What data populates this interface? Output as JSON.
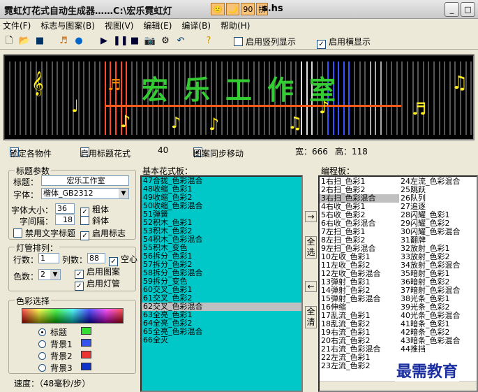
{
  "window": {
    "title": "霓虹灯花式自动生成器……C:\\宏乐霓虹灯",
    "ime": [
      "🙂",
      "🌙",
      "90",
      "拼"
    ],
    "title_suffix": "s.hs",
    "min": "_",
    "max": "□"
  },
  "menu": [
    "文件(F)",
    "标志与图案(B)",
    "视图(V)",
    "编辑(E)",
    "编译(B)",
    "帮助(H)"
  ],
  "toolbar": {
    "vertical_display": "启用竖列显示",
    "horizontal_display": "启用横显示"
  },
  "preview": {
    "title_text": "宏乐工作室",
    "bg": "#000000",
    "text_color": "#33cc33"
  },
  "status": {
    "lock_all": "锁定各物件",
    "enable_title_style": "启用标题花式",
    "count": "40",
    "pattern_sync": "图案同步移动",
    "width": "宽：666",
    "height": "高：118"
  },
  "title_params": {
    "legend": "标题参数",
    "title_label": "标题：",
    "title_value": "宏乐工作室",
    "font_label": "字体：",
    "font_value": "楷体_GB2312",
    "size_label": "字体大小：",
    "size_value": "36",
    "bold": "粗体",
    "spacing_label": "字间隔：",
    "spacing_value": "18",
    "italic": "斜体",
    "disable_text_title": "禁用文字标题",
    "enable_logo": "启用标志"
  },
  "tube": {
    "legend": "灯管排列：",
    "rows_label": "行数：",
    "rows_value": "1",
    "cols_label": "列数：",
    "cols_value": "88",
    "hollow": "空心",
    "colors_label": "色数：",
    "colors_value": "2",
    "enable_pattern": "启用图案",
    "enable_tube": "启用灯管"
  },
  "color": {
    "legend": "色彩选择",
    "options": [
      {
        "label": "标题",
        "color": "#33dd33"
      },
      {
        "label": "背景1",
        "color": "#3355ee"
      },
      {
        "label": "背景2",
        "color": "#ee3333"
      },
      {
        "label": "背景3",
        "color": "#1133cc"
      }
    ]
  },
  "speed": {
    "label": "速度：（48毫秒/步）"
  },
  "basic_board": {
    "legend": "基本花式板：",
    "items": [
      "47合拢_色彩混合",
      "48收缩_色彩1",
      "49收缩_色彩2",
      "50收缩_色彩混合",
      "51弹簧",
      "52积木_色彩1",
      "53积木_色彩2",
      "54积木_色彩混合",
      "55积木_变色",
      "56拆分_色彩1",
      "57拆分_色彩2",
      "58拆分_色彩混合",
      "59拆分_变色",
      "60交叉_色彩1",
      "61交叉_色彩2",
      "62交叉_色彩混合",
      "63全亮_色彩1",
      "64全亮_色彩2",
      "65全亮_色彩混合",
      "66全灭"
    ],
    "selected_index": 15
  },
  "side_buttons": {
    "right": "→",
    "select_all": "全选",
    "left": "←",
    "clear_all": "全清"
  },
  "edit_board": {
    "legend": "编程板：",
    "col1": [
      "1右扫_色彩1",
      "2右扫_色彩2",
      "3右扫_色彩混合",
      "4右收_色彩1",
      "5右收_色彩2",
      "6右收_色彩混合",
      "7左扫_色彩1",
      "8左扫_色彩2",
      "9左扫_色彩混合",
      "10左收_色彩1",
      "11左收_色彩2",
      "12左收_色彩混合",
      "13弹射_色彩1",
      "14弹射_色彩2",
      "15弹射_色彩混合",
      "16伸缩",
      "17乱流_色彩1",
      "18乱流_色彩2",
      "19右流_色彩1",
      "20右流_色彩2",
      "21右流_色彩混合",
      "22左流_色彩1",
      "23左流_色彩2"
    ],
    "col2": [
      "24左流_色彩混合",
      "25跳跃",
      "26队列",
      "27追逐",
      "28闪耀_色彩1",
      "29闪耀_色彩2",
      "30闪耀_色彩混合",
      "31翻牌",
      "32放射_色彩1",
      "33放射_色彩2",
      "34放射_色彩混合",
      "35暗射_色彩1",
      "36暗射_色彩2",
      "37暗射_色彩混合",
      "38光条_色彩1",
      "39光条_色彩2",
      "40光条_色彩混合",
      "41暗条_色彩1",
      "42暗条_色彩2",
      "43暗条_色彩混合",
      "44推挡"
    ],
    "selected_index": 2
  },
  "watermark": "最需教育"
}
